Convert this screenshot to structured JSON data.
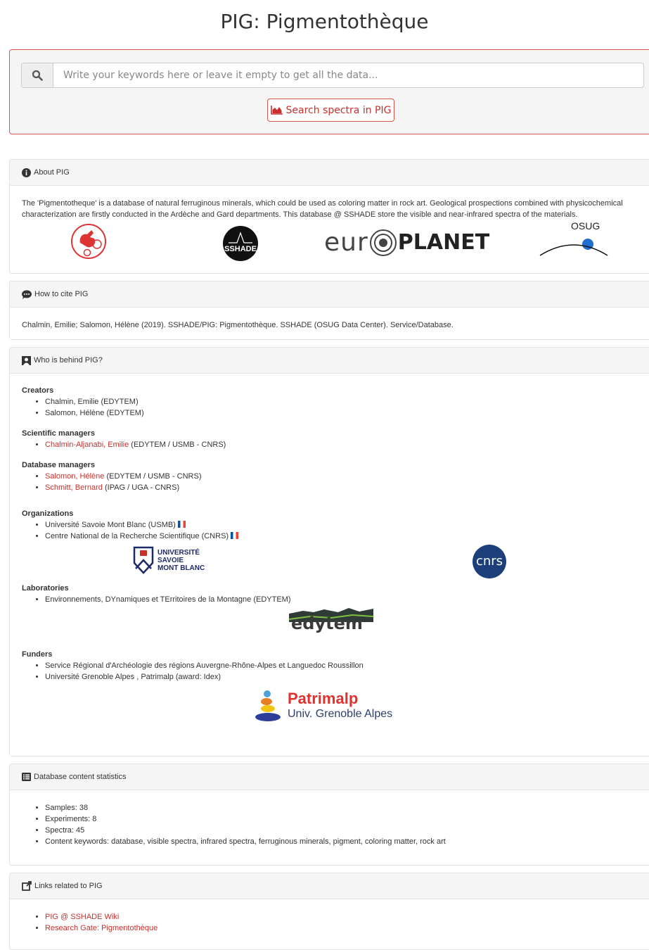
{
  "page_title": "PIG: Pigmentothèque",
  "search": {
    "placeholder": "Write your keywords here or leave it empty to get all the data...",
    "button_label": "Search spectra in PIG"
  },
  "about": {
    "heading": "About PIG",
    "text": "The 'Pigmentotheque' is a database of natural ferruginous minerals, which could be used as coloring matter in rock art. Geological prospections combined with physicochemical characterization are firstly conducted in the Ardèche and Gard departments. This database @ SSHADE store the visible and near-infrared spectra of the materials.",
    "logos": {
      "sshade": "SSHADE",
      "europlanet_a": "eur",
      "europlanet_b": "PLANET",
      "osug": "OSUG"
    }
  },
  "cite": {
    "heading": "How to cite PIG",
    "text": "Chalmin, Emilie; Salomon, Hélène (2019). SSHADE/PIG: Pigmentothèque. SSHADE (OSUG Data Center). Service/Database."
  },
  "who": {
    "heading": "Who is behind PIG?",
    "creators_title": "Creators",
    "creators": [
      "Chalmin, Emilie (EDYTEM)",
      "Salomon, Hélène (EDYTEM)"
    ],
    "sci_title": "Scientific managers",
    "sci": [
      {
        "link": "Chalmin-Aljanabi, Emilie",
        "rest": " (EDYTEM / USMB - CNRS)"
      }
    ],
    "db_title": "Database managers",
    "db": [
      {
        "link": "Salomon, Hélène",
        "rest": " (EDYTEM / USMB - CNRS)"
      },
      {
        "link": "Schmitt, Bernard",
        "rest": " (IPAG / UGA - CNRS)"
      }
    ],
    "org_title": "Organizations",
    "orgs": [
      "Université Savoie Mont Blanc (USMB)",
      "Centre National de la Recherche Scientifique (CNRS)"
    ],
    "usmb_logo": [
      "UNIVERSITÉ",
      "SAVOIE",
      "MONT BLANC"
    ],
    "cnrs_logo": "cnrs",
    "lab_title": "Laboratories",
    "labs": [
      "Environnements, DYnamiques et TErritoires de la Montagne (EDYTEM)"
    ],
    "edytem_logo": "edytem",
    "fund_title": "Funders",
    "funders": [
      "Service Régional d'Archéologie des régions Auvergne-Rhône-Alpes et Languedoc Roussillon",
      "Université Grenoble Alpes , Patrimalp (award: Idex)"
    ],
    "patrimalp_logo": [
      "Patrimalp",
      "Univ. Grenoble Alpes"
    ]
  },
  "stats": {
    "heading": "Database content statistics",
    "items": [
      "Samples: 38",
      "Experiments: 8",
      "Spectra: 45",
      "Content keywords: database, visible spectra, infrared spectra, ferruginous minerals, pigment, coloring matter, rock art"
    ]
  },
  "links": {
    "heading": "Links related to PIG",
    "items": [
      "PIG @ SSHADE Wiki",
      "Research Gate: Pigmentothèque"
    ]
  },
  "colors": {
    "accent": "#c9302c",
    "panel_bg": "#f5f5f5"
  }
}
